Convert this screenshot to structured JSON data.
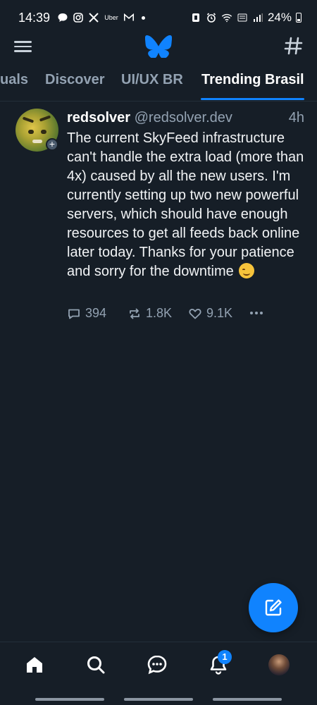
{
  "status_bar": {
    "time": "14:39",
    "notification_icons": [
      "chat-icon",
      "instagram-icon",
      "x-icon",
      "uber-icon",
      "gmail-icon"
    ],
    "uber_label": "Uber",
    "battery": "24%",
    "right_icons": [
      "nfc-icon",
      "alarm-icon",
      "wifi-icon",
      "volte-icon",
      "signal-icon",
      "battery-icon"
    ]
  },
  "app_bar": {
    "menu_icon": "hamburger-menu-icon",
    "logo_icon": "bluesky-butterfly-icon",
    "feeds_icon": "hashtag-icon"
  },
  "tabs": [
    {
      "label": "uals",
      "active": false
    },
    {
      "label": "Discover",
      "active": false
    },
    {
      "label": "UI/UX BR",
      "active": false
    },
    {
      "label": "Trending Brasil",
      "active": true
    }
  ],
  "post": {
    "author": "redsolver",
    "handle": "@redsolver.dev",
    "time": "4h",
    "text": "The current SkyFeed infrastructure can't handle the extra load (more than 4x) caused by all the new users. I'm currently setting up two new powerful servers, which should have enough resources to get all feeds back online later today. Thanks for your patience and sorry for the downtime",
    "emoji": "smiling-face-emoji",
    "replies": "394",
    "reposts": "1.8K",
    "likes": "9.1K"
  },
  "fab": {
    "icon": "compose-icon"
  },
  "bottom_nav": {
    "items": [
      "home-icon",
      "search-icon",
      "chat-icon",
      "bell-icon",
      "profile-avatar"
    ],
    "notification_badge": "1"
  },
  "colors": {
    "background": "#161e27",
    "accent": "#1083fe",
    "muted_text": "#93a2b2"
  }
}
